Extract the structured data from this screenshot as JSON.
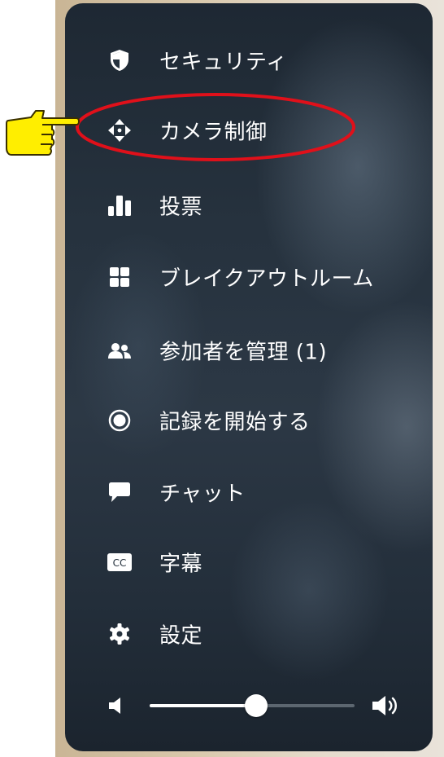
{
  "menu": {
    "items": [
      {
        "label": "セキュリティ",
        "icon": "shield-icon"
      },
      {
        "label": "カメラ制御",
        "icon": "move-arrows-icon"
      },
      {
        "label": "投票",
        "icon": "bar-chart-icon"
      },
      {
        "label": "ブレイクアウトルーム",
        "icon": "grid-icon"
      },
      {
        "label": "参加者を管理 (1)",
        "icon": "users-icon"
      },
      {
        "label": "記録を開始する",
        "icon": "record-icon"
      },
      {
        "label": "チャット",
        "icon": "chat-bubble-icon"
      },
      {
        "label": "字幕",
        "icon": "cc-icon",
        "icon_text": "CC"
      },
      {
        "label": "設定",
        "icon": "gear-icon"
      }
    ]
  },
  "volume": {
    "level": 0.52
  },
  "annotation": {
    "highlight_color": "#e0101a",
    "pointer_color": "#ffee00"
  },
  "colors": {
    "panel": "#26323e",
    "text": "#ffffff"
  }
}
